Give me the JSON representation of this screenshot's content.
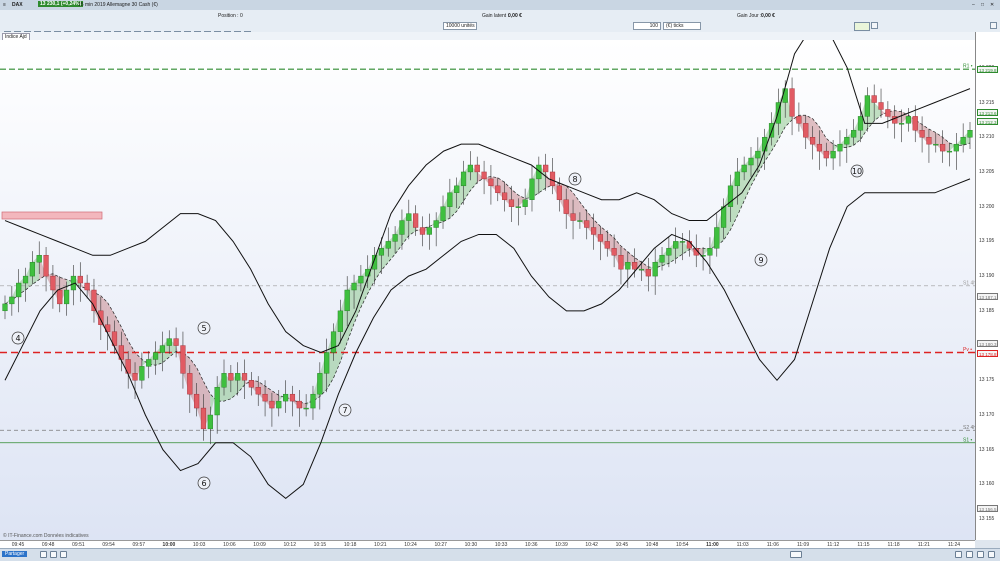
{
  "title_bar": {
    "symbol": "DAX",
    "quote": "13 230,1 (+0,24%)",
    "contract": "15 min  2019  Allemagne 30 Cash (€)"
  },
  "toolbar": {
    "position_label": "Position :",
    "position_value": "0",
    "gain_latent_label": "Gain latent :",
    "gain_latent_value": "0,00 €",
    "gain_jour_label": "Gain Jour :",
    "gain_jour_value": "0,00 €",
    "units_field": "10000 unités",
    "qty_field": "100",
    "type_field": "(€) ticks"
  },
  "chart_tab": "Indice Ajd",
  "watermark": "© IT-Finance.com  Données indicatives",
  "annotations": [
    "4",
    "5",
    "6",
    "7",
    "8",
    "9",
    "10"
  ],
  "level_labels": {
    "r1": "R1 •",
    "s1_dash": "S1 4h",
    "pivot": "Pv •",
    "s2": "S2 4h",
    "s1": "S1 •"
  },
  "price_boxes": [
    "13 219,8",
    "13 213,6",
    "13 212,3",
    "13 187,1",
    "13 180,3",
    "13 178,8",
    "13 156,5"
  ],
  "status": {
    "share_label": "Partager"
  },
  "chart_data": {
    "type": "candlestick",
    "instrument": "DAX",
    "timeframe": "15 min",
    "x_tick_labels": [
      "09:45",
      "09:48",
      "09:51",
      "09:54",
      "09:57",
      "10:00",
      "10:03",
      "10:06",
      "10:09",
      "10:12",
      "10:15",
      "10:18",
      "10:21",
      "10:24",
      "10:27",
      "10:30",
      "10:33",
      "10:36",
      "10:39",
      "10:42",
      "10:45",
      "10:48",
      "10:54",
      "11:00",
      "11:03",
      "11:06",
      "11:09",
      "11:12",
      "11:15",
      "11:18",
      "11:21",
      "11:24"
    ],
    "y_tick_labels": [
      "13 220",
      "13 215",
      "13 210",
      "13 205",
      "13 200",
      "13 195",
      "13 190",
      "13 185",
      "13 180",
      "13 175",
      "13 170",
      "13 165",
      "13 160",
      "13 155"
    ],
    "ylim": [
      13152,
      13224
    ],
    "levels": {
      "R1": 13219.8,
      "S1_4h": 13188.6,
      "Pivot": 13179.0,
      "S2_4h": 13167.8,
      "S1": 13166.0
    },
    "close_path": [
      13186,
      13187,
      13189,
      13190,
      13192,
      13193,
      13190,
      13188,
      13186,
      13188,
      13190,
      13189,
      13188,
      13185,
      13183,
      13182,
      13180,
      13178,
      13176,
      13175,
      13177,
      13178,
      13179,
      13180,
      13181,
      13180,
      13176,
      13173,
      13171,
      13168,
      13170,
      13174,
      13176,
      13175,
      13176,
      13175,
      13174,
      13173,
      13172,
      13171,
      13172,
      13173,
      13172,
      13171,
      13171,
      13173,
      13176,
      13179,
      13182,
      13185,
      13188,
      13189,
      13190,
      13191,
      13193,
      13194,
      13195,
      13196,
      13198,
      13199,
      13197,
      13196,
      13197,
      13198,
      13200,
      13202,
      13203,
      13205,
      13206,
      13205,
      13204,
      13203,
      13202,
      13201,
      13200,
      13200,
      13201,
      13204,
      13206,
      13205,
      13203,
      13201,
      13199,
      13198,
      13198,
      13197,
      13196,
      13195,
      13194,
      13193,
      13191,
      13192,
      13191,
      13191,
      13190,
      13192,
      13193,
      13194,
      13195,
      13195,
      13194,
      13193,
      13193,
      13194,
      13197,
      13200,
      13203,
      13205,
      13206,
      13207,
      13208,
      13210,
      13212,
      13215,
      13217,
      13213,
      13212,
      13210,
      13209,
      13208,
      13207,
      13208,
      13209,
      13210,
      13211,
      13213,
      13216,
      13215,
      13214,
      13213,
      13212,
      13212,
      13213,
      13211,
      13210,
      13209,
      13209,
      13208,
      13208,
      13209,
      13210,
      13211
    ],
    "upper_band": [
      13198,
      13197,
      13196,
      13195,
      13194,
      13193,
      13193,
      13194,
      13195,
      13197,
      13199,
      13199,
      13198,
      13195,
      13191,
      13186,
      13182,
      13180,
      13179,
      13180,
      13185,
      13192,
      13199,
      13203,
      13206,
      13208,
      13209,
      13209,
      13208,
      13207,
      13206,
      13204,
      13203,
      13202,
      13201,
      13201,
      13202,
      13201,
      13199,
      13198,
      13198,
      13200,
      13202,
      13206,
      13213,
      13222,
      13226,
      13225,
      13220,
      13212,
      13212,
      13213,
      13214,
      13215,
      13216,
      13217
    ],
    "lower_band": [
      13175,
      13180,
      13185,
      13188,
      13189,
      13186,
      13181,
      13176,
      13170,
      13165,
      13162,
      13163,
      13166,
      13166,
      13164,
      13160,
      13158,
      13160,
      13166,
      13173,
      13179,
      13184,
      13188,
      13190,
      13191,
      13193,
      13195,
      13196,
      13196,
      13194,
      13190,
      13187,
      13185,
      13185,
      13186,
      13188,
      13191,
      13194,
      13196,
      13195,
      13192,
      13188,
      13183,
      13178,
      13175,
      13178,
      13186,
      13194,
      13200,
      13202,
      13202,
      13202,
      13202,
      13202,
      13203,
      13204
    ]
  }
}
